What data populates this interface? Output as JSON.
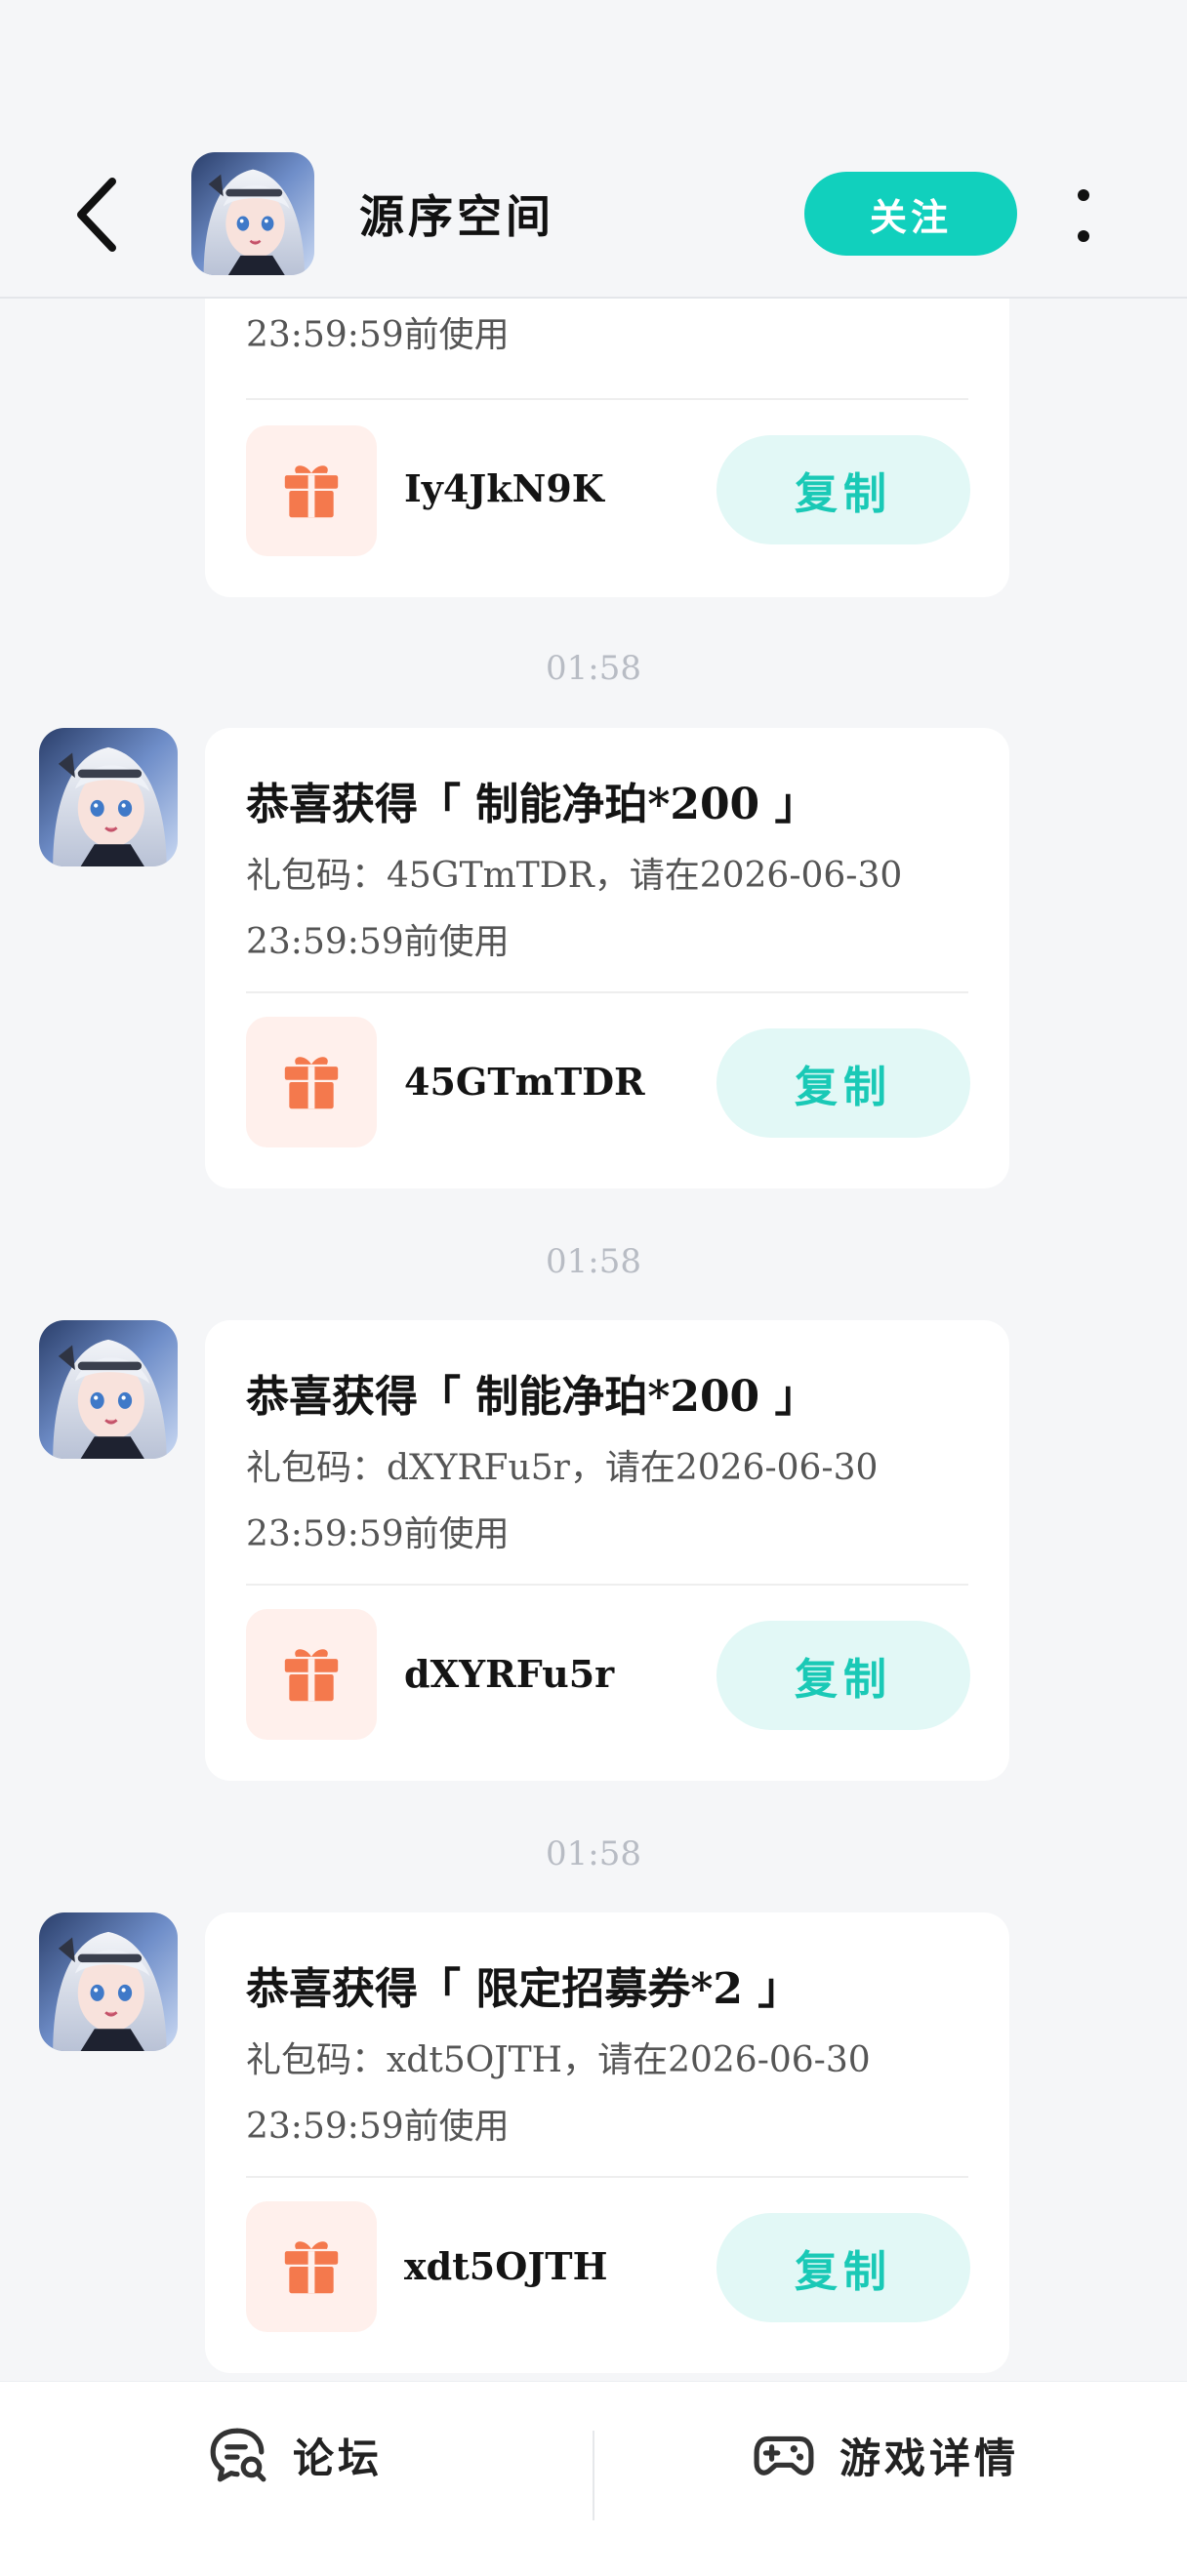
{
  "header": {
    "title": "源序空间",
    "follow_label": "关注"
  },
  "messages": [
    {
      "time": "",
      "title": "",
      "desc_line1": "",
      "desc_line2": "23:59:59前使用",
      "code": "Iy4JkN9K",
      "copy_label": "复制"
    },
    {
      "time": "01:58",
      "title": "恭喜获得「 制能净珀*200 」",
      "desc_line1": "礼包码：45GTmTDR，请在2026-06-30",
      "desc_line2": "23:59:59前使用",
      "code": "45GTmTDR",
      "copy_label": "复制"
    },
    {
      "time": "01:58",
      "title": "恭喜获得「 制能净珀*200 」",
      "desc_line1": "礼包码：dXYRFu5r，请在2026-06-30",
      "desc_line2": "23:59:59前使用",
      "code": "dXYRFu5r",
      "copy_label": "复制"
    },
    {
      "time": "01:58",
      "title": "恭喜获得「 限定招募券*2 」",
      "desc_line1": "礼包码：xdt5OJTH，请在2026-06-30",
      "desc_line2": "23:59:59前使用",
      "code": "xdt5OJTH",
      "copy_label": "复制"
    }
  ],
  "bottom_bar": {
    "forum_label": "论坛",
    "game_details_label": "游戏详情"
  },
  "colors": {
    "accent": "#11d0bd",
    "copy_bg": "#e2f8f6",
    "gift_icon": "#f4794d",
    "gift_bg": "#fff0ec"
  }
}
